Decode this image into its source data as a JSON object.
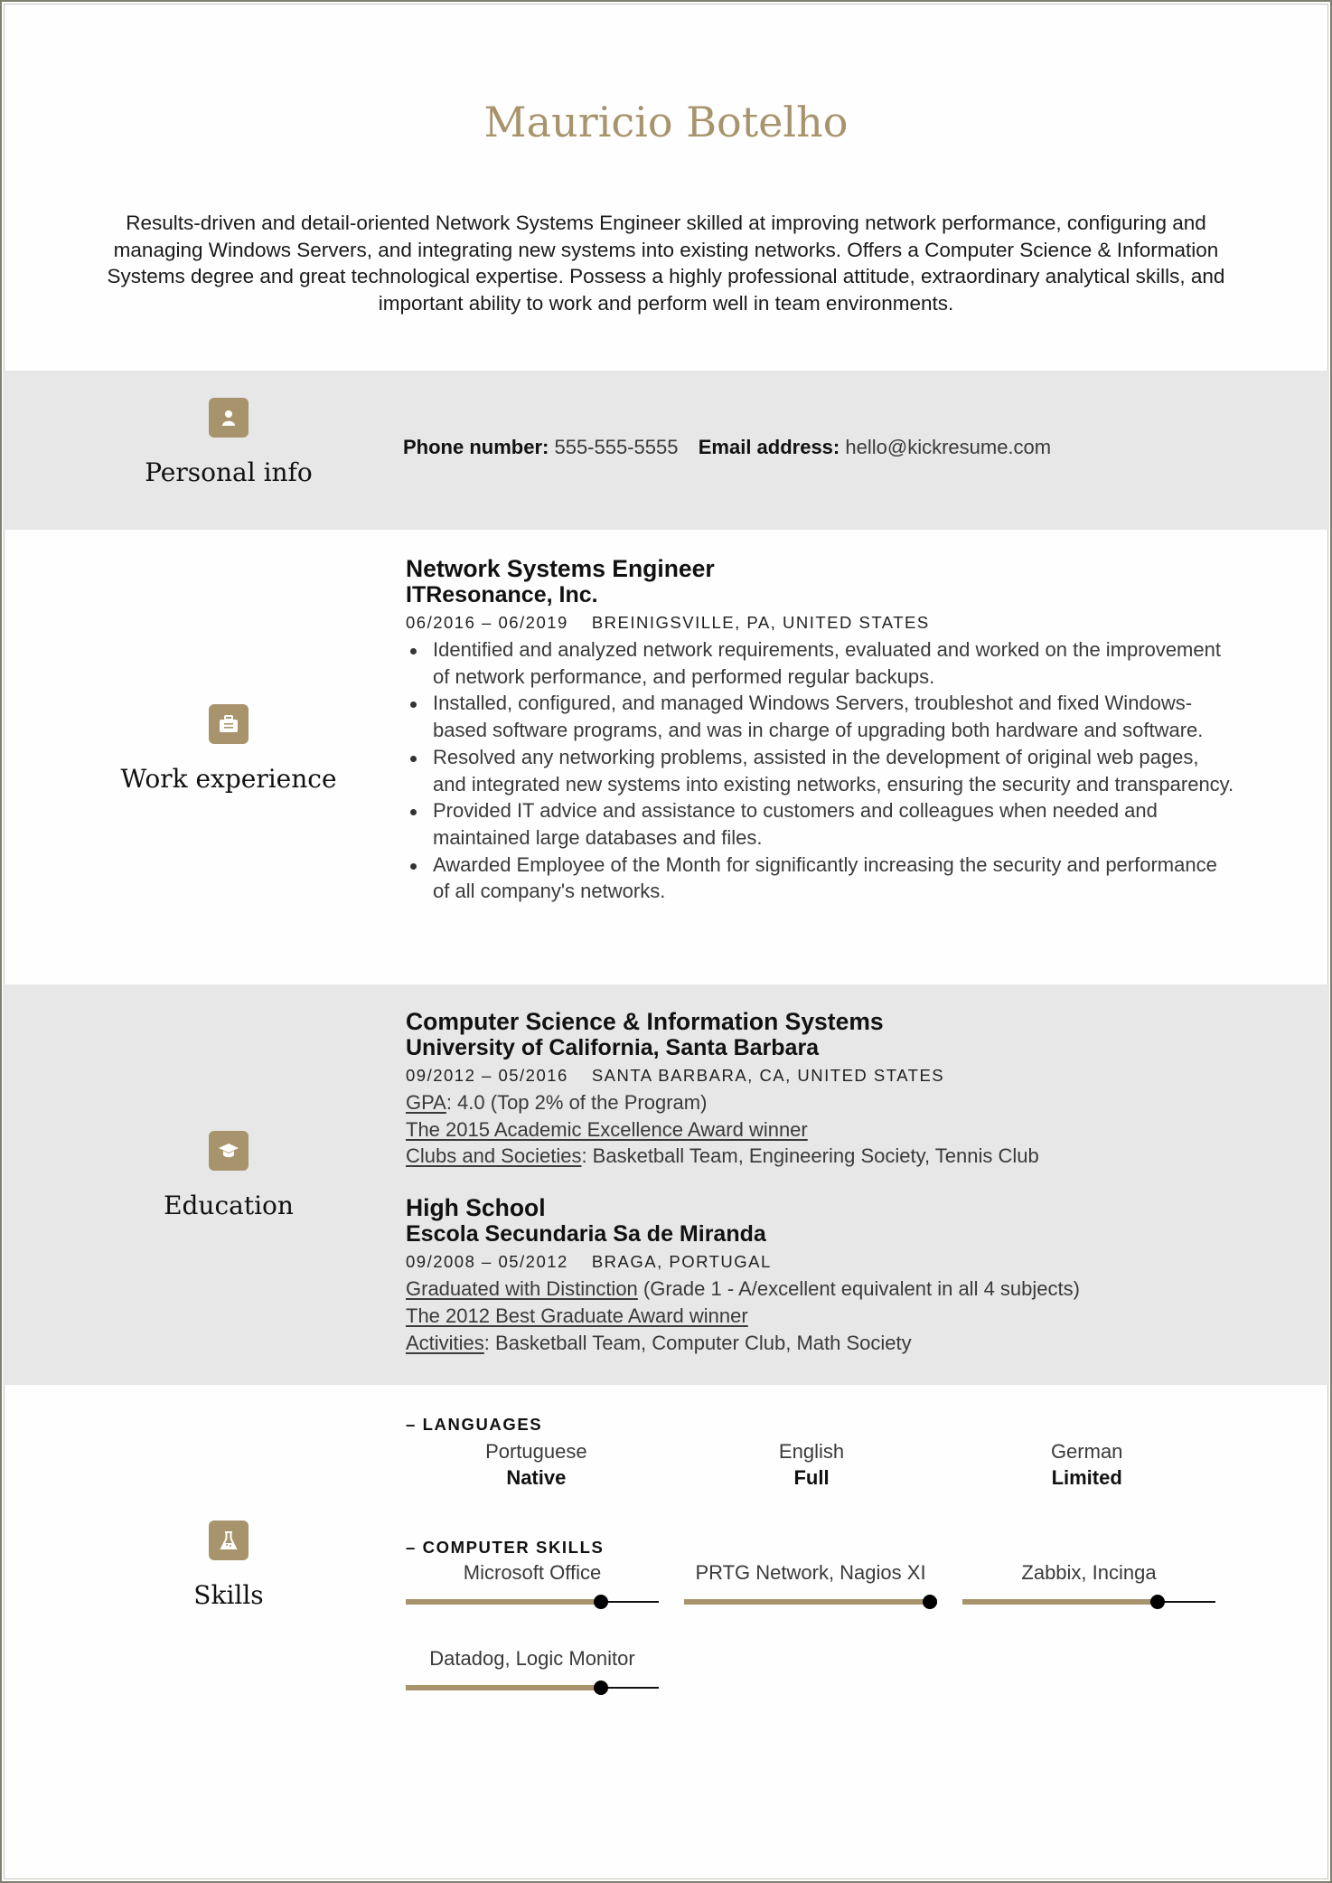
{
  "header": {
    "name": "Mauricio Botelho",
    "summary": "Results-driven and detail-oriented Network Systems Engineer skilled at improving network performance, configuring and managing Windows Servers, and integrating new systems into existing networks. Offers a Computer Science & Information Systems degree and great technological expertise. Possess a highly professional attitude, extraordinary analytical skills, and important ability to work and perform well in team environments."
  },
  "colors": {
    "accent": "#a8946c",
    "band_grey": "#e7e7e7",
    "text": "#333333"
  },
  "personal_info": {
    "title": "Personal info",
    "icon": "person-icon",
    "phone_label": "Phone number:",
    "phone": "555-555-5555",
    "email_label": "Email address:",
    "email": "hello@kickresume.com"
  },
  "work_experience": {
    "title": "Work experience",
    "icon": "briefcase-icon",
    "jobs": [
      {
        "position": "Network Systems Engineer",
        "company": "ITResonance, Inc.",
        "dates": "06/2016 – 06/2019",
        "location": "BREINIGSVILLE, PA, UNITED STATES",
        "bullets": [
          "Identified and analyzed network requirements, evaluated and worked on the improvement of network performance, and performed regular backups.",
          "Installed, configured, and managed Windows Servers, troubleshot and fixed Windows-based software programs, and was in charge of upgrading both hardware and software.",
          "Resolved any networking problems, assisted in the development of original web pages, and integrated new systems into existing networks, ensuring the security and transparency.",
          "Provided IT advice and assistance to customers and colleagues when needed and maintained large databases and files.",
          "Awarded Employee of the Month for significantly increasing the security and performance of all company's networks."
        ]
      }
    ]
  },
  "education": {
    "title": "Education",
    "icon": "graduation-cap-icon",
    "schools": [
      {
        "degree": "Computer Science & Information Systems",
        "school": "University of California, Santa Barbara",
        "dates": "09/2012 – 05/2016",
        "location": "SANTA BARBARA, CA, UNITED STATES",
        "lines": [
          {
            "label": "GPA",
            "text": ": 4.0 (Top 2% of the Program)"
          },
          {
            "label": "The 2015 Academic Excellence Award winner",
            "text": ""
          },
          {
            "label": "Clubs and Societies",
            "text": ": Basketball Team, Engineering Society, Tennis Club"
          }
        ]
      },
      {
        "degree": "High School",
        "school": "Escola Secundaria Sa de Miranda",
        "dates": "09/2008 – 05/2012",
        "location": "BRAGA, PORTUGAL",
        "lines": [
          {
            "label": "Graduated with Distinction",
            "text": " (Grade 1 - A/excellent equivalent in all 4 subjects)"
          },
          {
            "label": "The 2012 Best Graduate Award winner",
            "text": ""
          },
          {
            "label": "Activities",
            "text": ": Basketball Team, Computer Club, Math Society"
          }
        ]
      }
    ]
  },
  "skills": {
    "title": "Skills",
    "icon": "flask-icon",
    "languages_heading": "– LANGUAGES",
    "languages": [
      {
        "name": "Portuguese",
        "level": "Native"
      },
      {
        "name": "English",
        "level": "Full"
      },
      {
        "name": "German",
        "level": "Limited"
      }
    ],
    "computer_heading": "– COMPUTER SKILLS",
    "computer_skills": [
      {
        "name": "Microsoft Office",
        "level_percent": 77
      },
      {
        "name": "PRTG Network, Nagios XI",
        "level_percent": 100
      },
      {
        "name": "Zabbix, Incinga",
        "level_percent": 77
      },
      {
        "name": "Datadog, Logic Monitor",
        "level_percent": 77
      }
    ]
  }
}
